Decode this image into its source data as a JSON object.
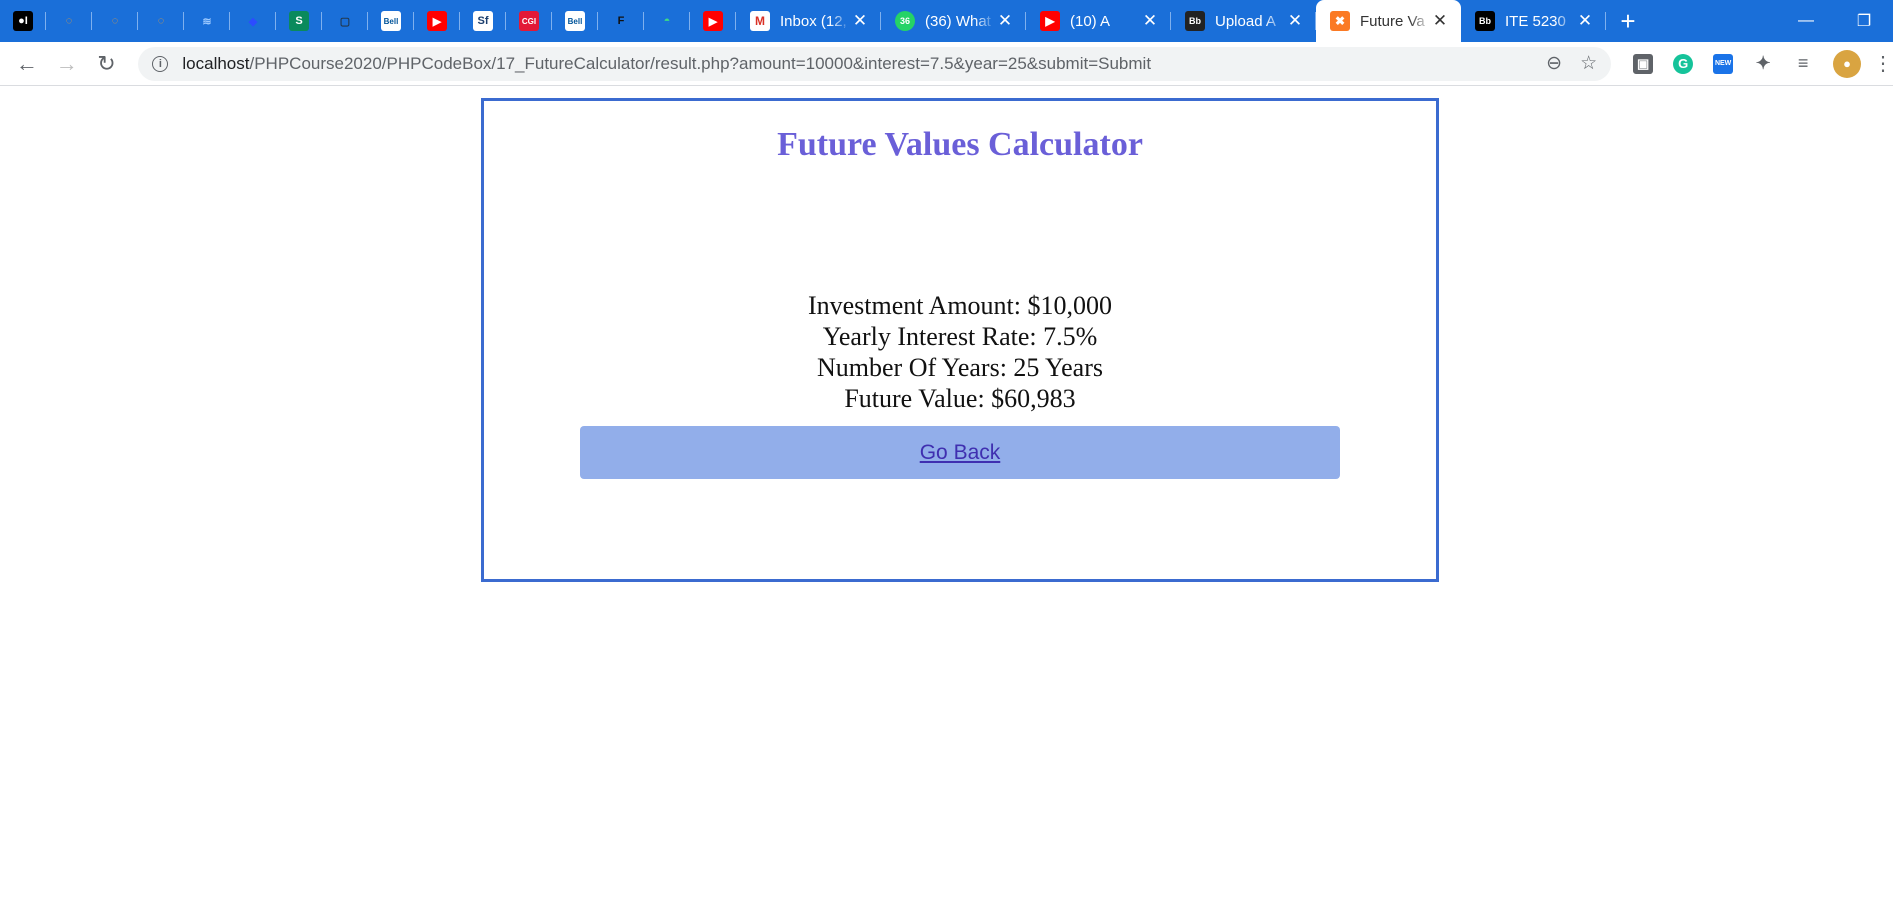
{
  "browser": {
    "pinned_tabs": [
      {
        "icon": "medium-icon",
        "glyph": "●I",
        "bg": "#000000",
        "fg": "#ffffff"
      },
      {
        "icon": "loader-icon",
        "glyph": "◌",
        "bg": "transparent",
        "fg": "#f0a030"
      },
      {
        "icon": "loader-icon",
        "glyph": "◌",
        "bg": "transparent",
        "fg": "#f0a030"
      },
      {
        "icon": "loader-icon",
        "glyph": "◌",
        "bg": "transparent",
        "fg": "#f0a030"
      },
      {
        "icon": "layers-icon",
        "glyph": "≋",
        "bg": "transparent",
        "fg": "#9cc9ff"
      },
      {
        "icon": "diamond-icon",
        "glyph": "◆",
        "bg": "transparent",
        "fg": "#2c4cff"
      },
      {
        "icon": "s-logo-icon",
        "glyph": "S",
        "bg": "#0a8a5c",
        "fg": "#ffffff"
      },
      {
        "icon": "square-icon",
        "glyph": "▢",
        "bg": "transparent",
        "fg": "#22384f"
      },
      {
        "icon": "bell-logo-icon",
        "glyph": "Bell",
        "bg": "#ffffff",
        "fg": "#00549a"
      },
      {
        "icon": "youtube-icon",
        "glyph": "▶",
        "bg": "#ff0000",
        "fg": "#ffffff"
      },
      {
        "icon": "sf-logo-icon",
        "glyph": "Sf",
        "bg": "#ffffff",
        "fg": "#1a3d6d"
      },
      {
        "icon": "cgi-logo-icon",
        "glyph": "CGI",
        "bg": "#e31937",
        "fg": "#ffffff"
      },
      {
        "icon": "bell-logo-icon",
        "glyph": "Bell",
        "bg": "#ffffff",
        "fg": "#00549a"
      },
      {
        "icon": "f-logo-icon",
        "glyph": "F",
        "bg": "transparent",
        "fg": "#111111"
      },
      {
        "icon": "android-icon",
        "glyph": "◓",
        "bg": "transparent",
        "fg": "#3ddc84"
      },
      {
        "icon": "youtube-icon",
        "glyph": "▶",
        "bg": "#ff0000",
        "fg": "#ffffff"
      }
    ],
    "tabs": [
      {
        "icon": "gmail-icon",
        "glyph": "M",
        "bg": "#ffffff",
        "fg": "#d93025",
        "title": "Inbox (12,",
        "active": false
      },
      {
        "icon": "whatsapp-icon",
        "glyph": "36",
        "bg": "#25d366",
        "fg": "#ffffff",
        "title": "(36) What",
        "active": false
      },
      {
        "icon": "youtube-icon",
        "glyph": "▶",
        "bg": "#ff0000",
        "fg": "#ffffff",
        "title": "(10) A",
        "active": false
      },
      {
        "icon": "blackboard-icon",
        "glyph": "Bb",
        "bg": "#222222",
        "fg": "#ffffff",
        "title": "Upload A",
        "active": false
      },
      {
        "icon": "xampp-icon",
        "glyph": "✖",
        "bg": "#fb7a24",
        "fg": "#ffffff",
        "title": "Future Va",
        "active": true
      },
      {
        "icon": "blackboard-icon",
        "glyph": "Bb",
        "bg": "#000000",
        "fg": "#ffffff",
        "title": "ITE 5230",
        "active": false
      }
    ],
    "url_host": "localhost",
    "url_path": "/PHPCourse2020/PHPCodeBox/17_FutureCalculator/result.php?amount=10000&interest=7.5&year=25&submit=Submit",
    "extensions": [
      {
        "icon": "extension-square-icon",
        "glyph": "▣",
        "bg": "#5f6368",
        "fg": "#ffffff"
      },
      {
        "icon": "grammarly-icon",
        "glyph": "G",
        "bg": "#15c39a",
        "fg": "#ffffff"
      },
      {
        "icon": "new-badge-icon",
        "glyph": "NEW",
        "bg": "#1a73e8",
        "fg": "#ffffff"
      },
      {
        "icon": "puzzle-icon",
        "glyph": "✦",
        "bg": "transparent",
        "fg": "#5f6368"
      },
      {
        "icon": "media-queue-icon",
        "glyph": "≡",
        "bg": "transparent",
        "fg": "#5f6368"
      }
    ]
  },
  "page": {
    "title": "Future Values Calculator",
    "results": [
      "Investment Amount: $10,000",
      "Yearly Interest Rate: 7.5%",
      "Number Of Years: 25 Years",
      "Future Value: $60,983"
    ],
    "back_label": "Go Back"
  }
}
